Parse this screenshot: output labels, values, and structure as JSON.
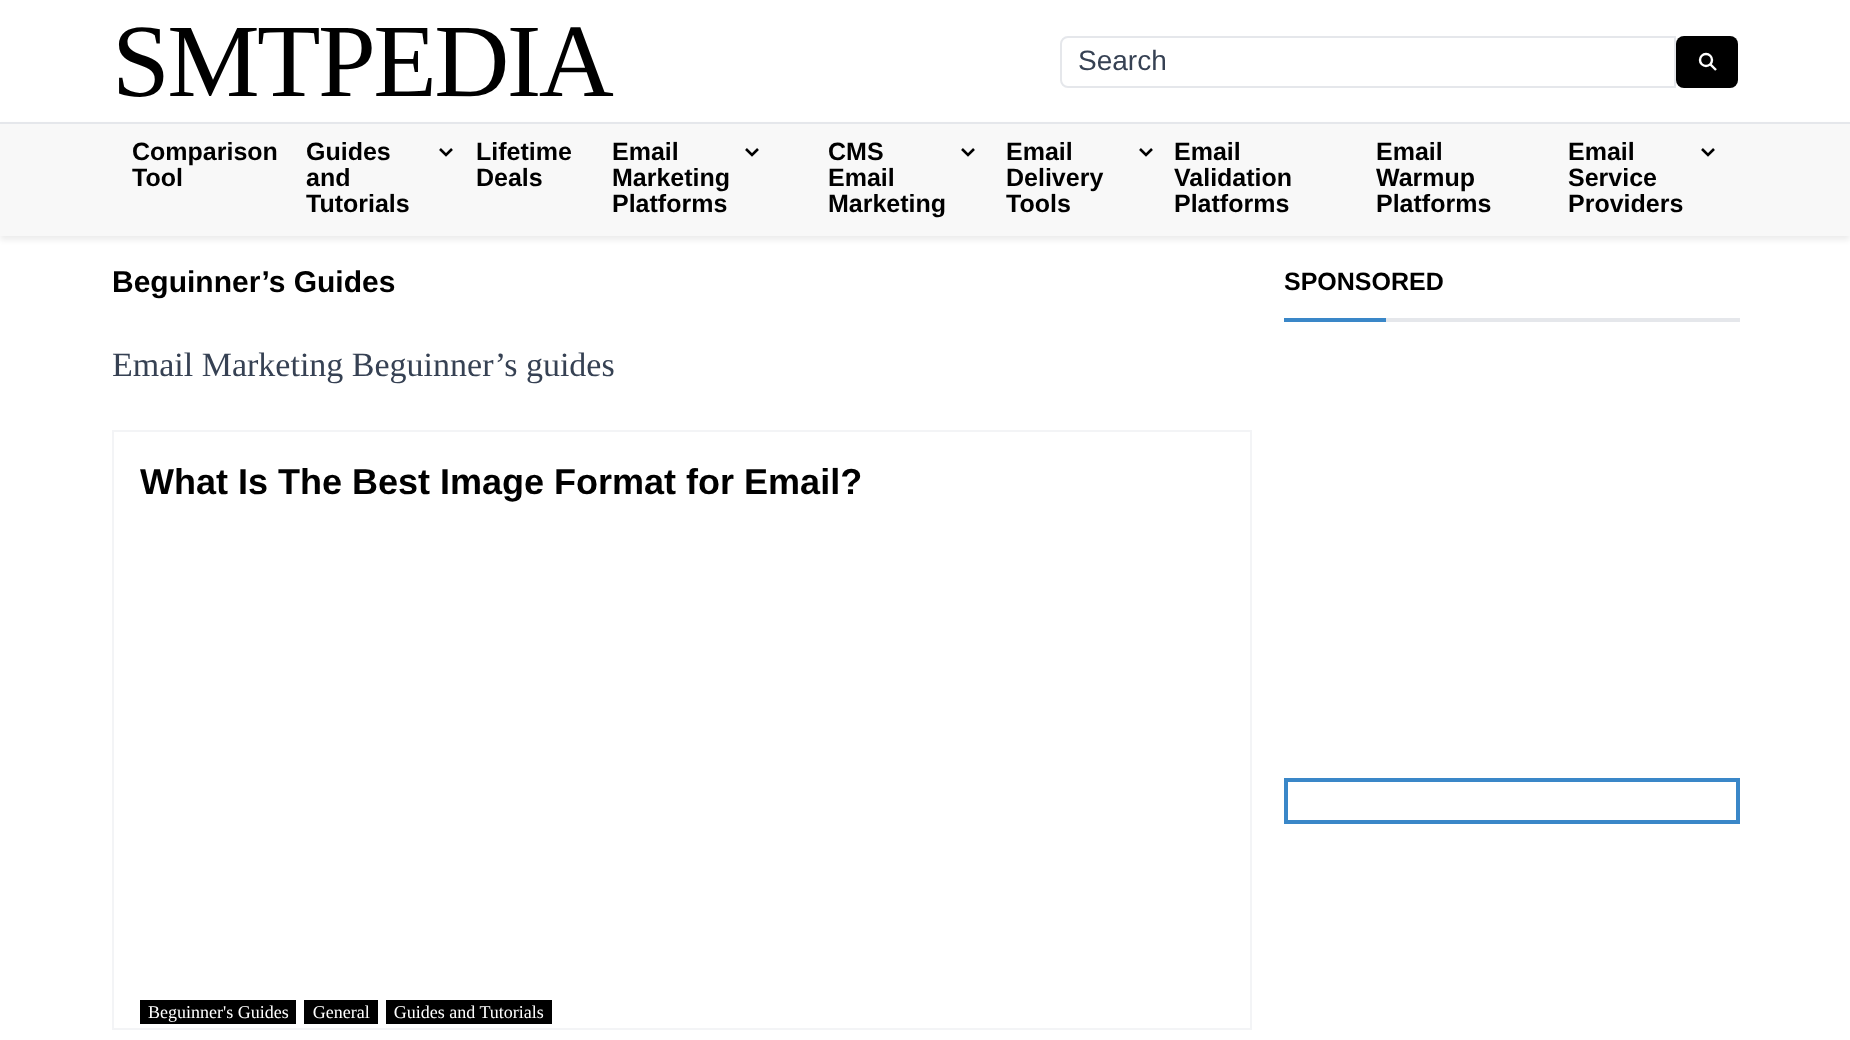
{
  "logo": "SMTPEDIA",
  "search": {
    "placeholder": "Search"
  },
  "nav": [
    {
      "label": "Comparison Tool",
      "has_dropdown": false
    },
    {
      "label": "Guides and Tutorials",
      "has_dropdown": true
    },
    {
      "label": "Lifetime Deals",
      "has_dropdown": false
    },
    {
      "label": "Email Marketing Platforms",
      "has_dropdown": true
    },
    {
      "label": "CMS Email Marketing",
      "has_dropdown": true
    },
    {
      "label": "Email Delivery Tools",
      "has_dropdown": true
    },
    {
      "label": "Email Validation Platforms",
      "has_dropdown": false
    },
    {
      "label": "Email Warmup Platforms",
      "has_dropdown": false
    },
    {
      "label": "Email Service Providers",
      "has_dropdown": true
    }
  ],
  "page": {
    "title": "Beguinner’s Guides",
    "description": "Email Marketing Beguinner’s guides"
  },
  "posts": [
    {
      "title": "What Is The Best Image Format for Email?",
      "tags": [
        "Beguinner's Guides",
        "General",
        "Guides and Tutorials"
      ]
    }
  ],
  "sidebar": {
    "heading": "SPONSORED"
  }
}
